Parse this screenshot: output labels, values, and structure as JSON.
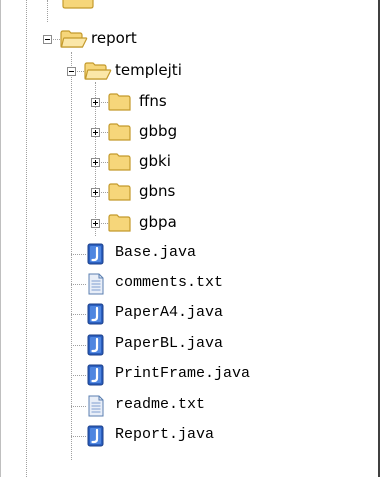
{
  "tree": {
    "nodes": [
      {
        "label": "report",
        "type": "folder",
        "state": "expanded",
        "icon": "folder-open-icon"
      },
      {
        "label": "templejti",
        "type": "folder",
        "state": "expanded",
        "icon": "folder-open-icon"
      },
      {
        "label": "ffns",
        "type": "folder",
        "state": "collapsed",
        "icon": "folder-icon"
      },
      {
        "label": "gbbg",
        "type": "folder",
        "state": "collapsed",
        "icon": "folder-icon"
      },
      {
        "label": "gbki",
        "type": "folder",
        "state": "collapsed",
        "icon": "folder-icon"
      },
      {
        "label": "gbns",
        "type": "folder",
        "state": "collapsed",
        "icon": "folder-icon"
      },
      {
        "label": "gbpa",
        "type": "folder",
        "state": "collapsed",
        "icon": "folder-icon"
      },
      {
        "label": "Base.java",
        "type": "java",
        "icon": "java-file-icon"
      },
      {
        "label": "comments.txt",
        "type": "text",
        "icon": "text-file-icon"
      },
      {
        "label": "PaperA4.java",
        "type": "java",
        "icon": "java-file-icon"
      },
      {
        "label": "PaperBL.java",
        "type": "java",
        "icon": "java-file-icon"
      },
      {
        "label": "PrintFrame.java",
        "type": "java",
        "icon": "java-file-icon"
      },
      {
        "label": "readme.txt",
        "type": "text",
        "icon": "text-file-icon"
      },
      {
        "label": "Report.java",
        "type": "java",
        "icon": "java-file-icon"
      }
    ]
  },
  "colors": {
    "folder_fill": "#f6d67a",
    "folder_stroke": "#c49a2c",
    "java_fill": "#2b5fbf",
    "java_stroke": "#1b3f8a",
    "text_fill": "#e8eef8",
    "text_stroke": "#5b7fb0",
    "guide": "#a0a0a0"
  }
}
